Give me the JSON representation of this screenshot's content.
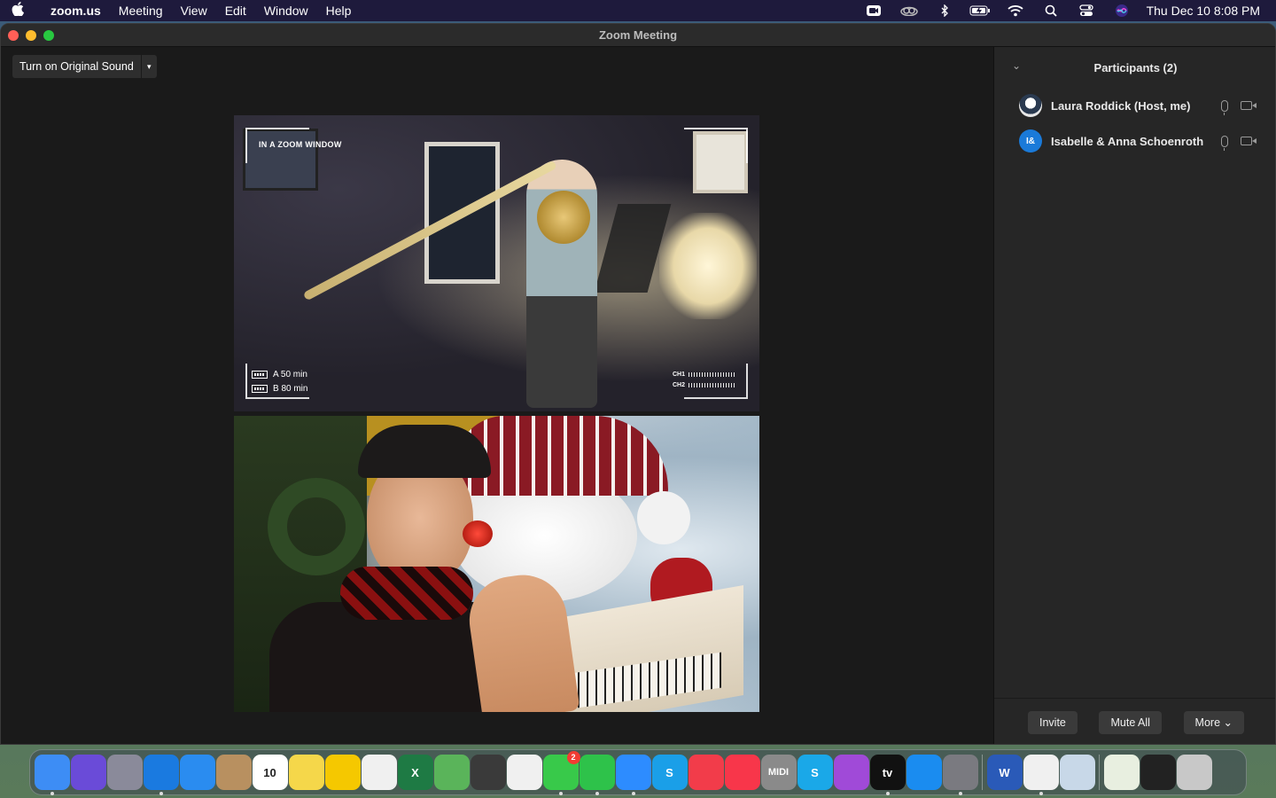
{
  "menubar": {
    "apple": "",
    "app_name": "zoom.us",
    "menus": [
      "Meeting",
      "View",
      "Edit",
      "Window",
      "Help"
    ],
    "clock": "Thu Dec 10  8:08 PM",
    "status_icons": [
      "zoom-status-icon",
      "creative-cloud-icon",
      "bluetooth-icon",
      "battery-icon",
      "wifi-icon",
      "spotlight-icon",
      "control-center-icon",
      "siri-icon"
    ]
  },
  "window": {
    "title": "Zoom Meeting"
  },
  "toolbar": {
    "original_sound_label": "Turn on Original Sound",
    "caret": "▾"
  },
  "video1": {
    "overlay_title": "IN A ZOOM WINDOW",
    "battery_a": "A   50 min",
    "battery_b": "B   80 min",
    "ch1": "CH1",
    "ch2": "CH2"
  },
  "participants": {
    "chevron": "⌄",
    "title": "Participants (2)",
    "list": [
      {
        "name": "Laura Roddick (Host, me)",
        "initials": ""
      },
      {
        "name": "Isabelle & Anna Schoenroth",
        "initials": "I&"
      }
    ]
  },
  "footer": {
    "invite": "Invite",
    "mute_all": "Mute All",
    "more": "More ⌄"
  },
  "dock": {
    "apps": [
      {
        "name": "finder",
        "color": "#3d8df5",
        "label": "",
        "running": true
      },
      {
        "name": "siri",
        "color": "#6a4bd8",
        "label": "",
        "running": false
      },
      {
        "name": "launchpad",
        "color": "#8a8a9a",
        "label": "",
        "running": false
      },
      {
        "name": "safari",
        "color": "#1a7ae0",
        "label": "",
        "running": true
      },
      {
        "name": "mail",
        "color": "#2a8cf0",
        "label": "",
        "running": false
      },
      {
        "name": "contacts",
        "color": "#b89060",
        "label": "",
        "running": false
      },
      {
        "name": "calendar",
        "color": "#ffffff",
        "label": "10",
        "running": false
      },
      {
        "name": "notes",
        "color": "#f5d74a",
        "label": "",
        "running": false
      },
      {
        "name": "cloud",
        "color": "#f5c800",
        "label": "",
        "running": false
      },
      {
        "name": "reminders",
        "color": "#f0f0f0",
        "label": "",
        "running": false
      },
      {
        "name": "excel",
        "color": "#1e7a44",
        "label": "X",
        "running": false
      },
      {
        "name": "maps",
        "color": "#5ab45a",
        "label": "",
        "running": false
      },
      {
        "name": "calculator",
        "color": "#3a3a3a",
        "label": "",
        "running": false
      },
      {
        "name": "photos",
        "color": "#f0f0f0",
        "label": "",
        "running": false
      },
      {
        "name": "messages",
        "color": "#38c94a",
        "label": "",
        "running": true,
        "badge": "2"
      },
      {
        "name": "facetime",
        "color": "#2ec24a",
        "label": "",
        "running": true
      },
      {
        "name": "zoom",
        "color": "#2d8cff",
        "label": "",
        "running": true
      },
      {
        "name": "skype",
        "color": "#1a9fe8",
        "label": "S",
        "running": false
      },
      {
        "name": "news",
        "color": "#f23c4a",
        "label": "",
        "running": false
      },
      {
        "name": "music",
        "color": "#f8364a",
        "label": "",
        "running": false
      },
      {
        "name": "midi",
        "color": "#8a8a8a",
        "label": "MIDI",
        "running": false
      },
      {
        "name": "scrobbles",
        "color": "#1aa8e8",
        "label": "S",
        "running": false
      },
      {
        "name": "podcasts",
        "color": "#a04ad8",
        "label": "",
        "running": false
      },
      {
        "name": "apple-tv",
        "color": "#111111",
        "label": "tv",
        "running": true
      },
      {
        "name": "app-store",
        "color": "#1a8cf0",
        "label": "",
        "running": false
      },
      {
        "name": "system-preferences",
        "color": "#7a7a80",
        "label": "",
        "running": true
      },
      {
        "name": "word",
        "color": "#2a5ab8",
        "label": "W",
        "running": false
      },
      {
        "name": "chrome",
        "color": "#f0f0f0",
        "label": "",
        "running": true
      },
      {
        "name": "preview",
        "color": "#c8d8e8",
        "label": "",
        "running": false
      },
      {
        "name": "html-file",
        "color": "#e8efe0",
        "label": "",
        "running": false
      },
      {
        "name": "screenshot-folder",
        "color": "#222222",
        "label": "",
        "running": false
      },
      {
        "name": "trash",
        "color": "#c8c8c8",
        "label": "",
        "running": false
      }
    ]
  }
}
